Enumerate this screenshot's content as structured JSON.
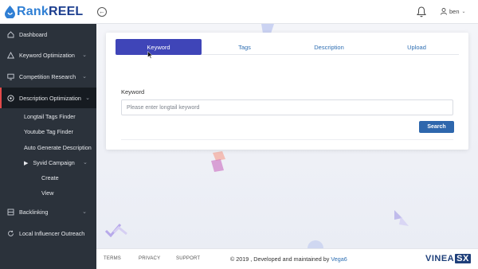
{
  "header": {
    "logo_part1": "Rank",
    "logo_part2": "REEL",
    "back_icon": "arrow-left-circle-icon",
    "user_name": "ben"
  },
  "sidebar": {
    "items": [
      {
        "label": "Dashboard",
        "icon": "home-icon"
      },
      {
        "label": "Keyword Optimization",
        "icon": "alert-triangle-icon"
      },
      {
        "label": "Competition Research",
        "icon": "monitor-icon"
      },
      {
        "label": "Description Optimization",
        "icon": "target-icon"
      },
      {
        "label": "Backlinking",
        "icon": "grid-icon"
      },
      {
        "label": "Local Influencer Outreach",
        "icon": "refresh-icon"
      }
    ],
    "sub_items": [
      "Longtail Tags Finder",
      "Youtube Tag Finder",
      "Auto Generate Description"
    ],
    "campaign": {
      "label": "Syvid Campaign",
      "children": [
        "Create",
        "View"
      ]
    }
  },
  "tabs": [
    "Keyword",
    "Tags",
    "Description",
    "Upload"
  ],
  "form": {
    "label": "Keyword",
    "placeholder": "Please enter longtail keyword",
    "button": "Search"
  },
  "footer": {
    "links": [
      "TERMS",
      "PRIVACY",
      "SUPPORT"
    ],
    "copyright": "© 2019 , Developed and maintained by ",
    "brand": "Vega6",
    "logo_main": "VINEA",
    "logo_suffix": "SX"
  },
  "colors": {
    "sidebar_bg": "#2b323b",
    "active_tab": "#3f45b8",
    "primary_button": "#2e67ad",
    "active_indicator": "#e24a4a"
  }
}
